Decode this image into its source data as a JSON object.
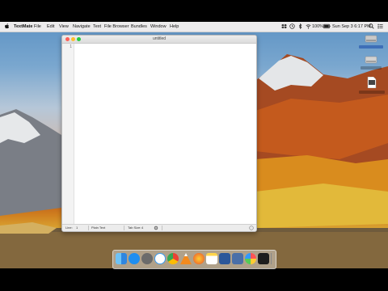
{
  "menubar": {
    "app_name": "TextMate",
    "items": [
      "File",
      "Edit",
      "View",
      "Navigate",
      "Text",
      "File Browser",
      "Bundles",
      "Window",
      "Help"
    ],
    "battery": "100%",
    "clock": "Sun Sep 3  6:17 PM"
  },
  "window": {
    "title": "untitled",
    "line_number": "1"
  },
  "statusbar": {
    "line_label": "Line:",
    "line_value": "1",
    "mode": "Plain Text",
    "tab_size": "Tab Size:",
    "tab_value": "4"
  },
  "colors": {
    "close": "#ff5f57",
    "minimize": "#ffbd2e",
    "zoom": "#28c940"
  },
  "dock": {
    "icons": [
      "finder-icon",
      "app-store-icon",
      "launchpad-icon",
      "safari-icon",
      "chrome-icon",
      "vlc-icon",
      "firefox-icon",
      "notes-icon",
      "word-icon",
      "hex-fiend-icon",
      "photos-icon",
      "terminal-icon",
      "textmate-icon",
      "trash-icon"
    ]
  }
}
